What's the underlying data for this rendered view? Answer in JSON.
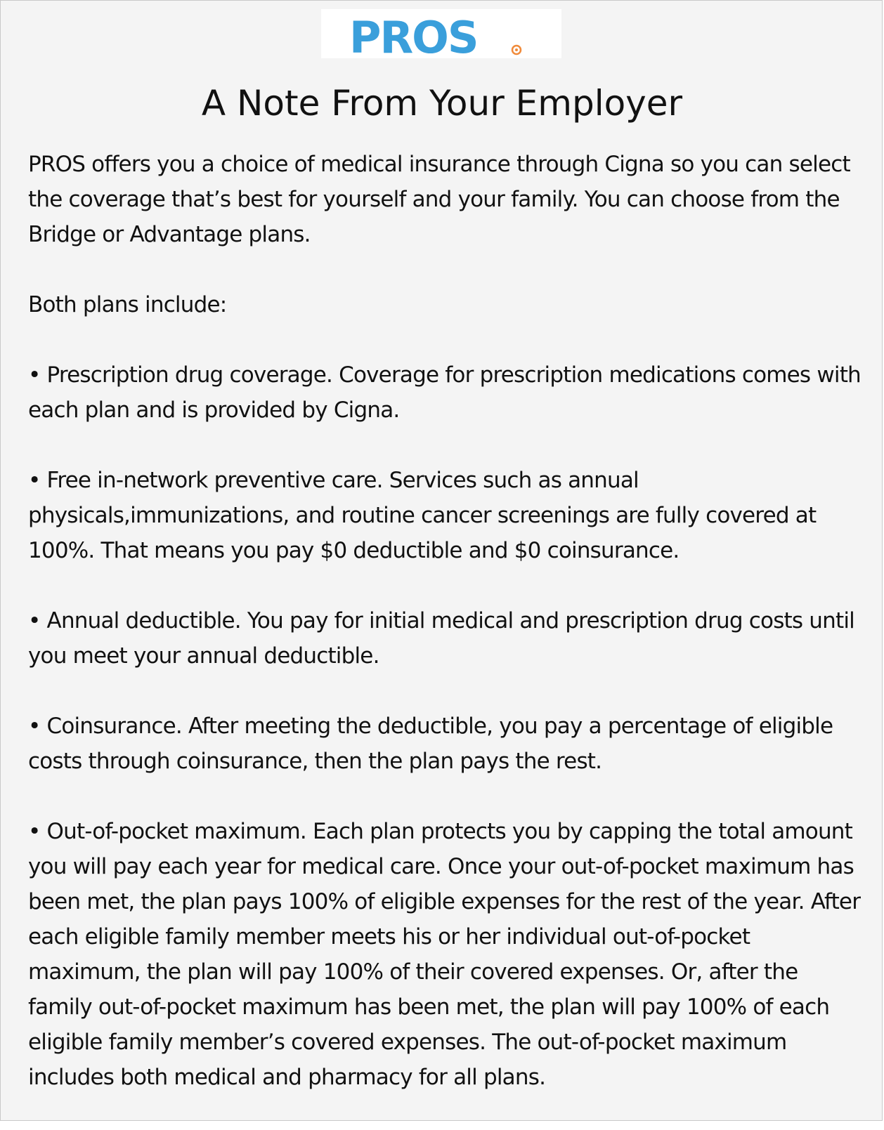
{
  "logo": {
    "text": "PROS",
    "brand_color": "#3a9fdb",
    "dot_color": "#f08a3a"
  },
  "note": {
    "title": "A Note From Your Employer",
    "paragraphs": [
      "PROS offers you a choice of medical insurance through Cigna so you can select the coverage that’s best for yourself and your family. You can choose from the Bridge or Advantage plans.",
      "Both plans include:",
      "• Prescription drug coverage. Coverage for prescription medications comes with each plan and is provided by Cigna.",
      "• Free in-network preventive care. Services such as annual physicals,immunizations, and routine cancer screenings are fully covered at 100%. That means you pay $0 deductible and $0 coinsurance.",
      "• Annual deductible. You pay for initial medical and prescription drug costs until you meet your annual deductible.",
      "• Coinsurance. After meeting the deductible, you pay a percentage of eligible costs through coinsurance, then the plan pays the rest.",
      "• Out-of-pocket maximum. Each plan protects you by capping the total amount you will pay each year for medical care. Once your out-of-pocket maximum has been met, the plan pays 100% of eligible expenses for the rest of the year. After each eligible family member meets his or her individual out-of-pocket maximum, the plan will pay 100% of their covered expenses. Or, after the family out-of-pocket maximum has been met, the plan will pay 100% of each eligible family member’s covered expenses. The out-of-pocket maximum includes both medical and pharmacy for all plans."
    ]
  }
}
